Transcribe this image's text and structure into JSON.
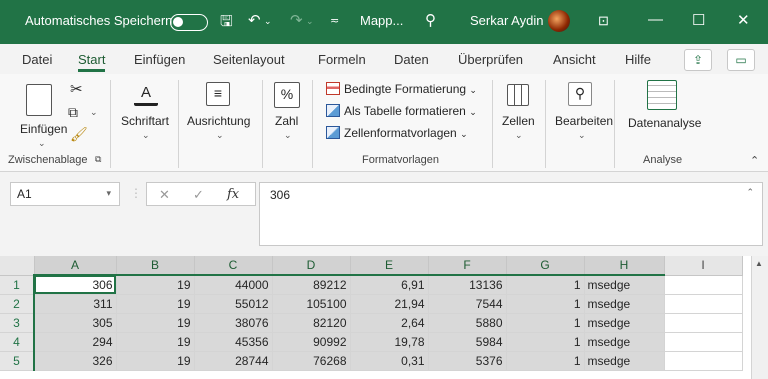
{
  "titlebar": {
    "autosave_label": "Automatisches Speichern",
    "filename": "Mapp...",
    "user_name": "Serkar Aydin"
  },
  "tabs": [
    "Datei",
    "Start",
    "Einfügen",
    "Seitenlayout",
    "Formeln",
    "Daten",
    "Überprüfen",
    "Ansicht",
    "Hilfe"
  ],
  "ribbon": {
    "paste_label": "Einfügen",
    "clipboard_group": "Zwischenablage",
    "font_label": "Schriftart",
    "align_label": "Ausrichtung",
    "number_label": "Zahl",
    "cond_format": "Bedingte Formatierung",
    "table_format": "Als Tabelle formatieren",
    "cell_styles": "Zellenformatvorlagen",
    "styles_group": "Formatvorlagen",
    "cells_label": "Zellen",
    "edit_label": "Bearbeiten",
    "analysis_label": "Datenanalyse",
    "analysis_group": "Analyse"
  },
  "formula_bar": {
    "name_box": "A1",
    "fx_symbol": "fx",
    "value": "306"
  },
  "sheet": {
    "columns": [
      "A",
      "B",
      "C",
      "D",
      "E",
      "F",
      "G",
      "H",
      "I"
    ],
    "rows": [
      {
        "n": "1",
        "cells": [
          "306",
          "19",
          "44000",
          "89212",
          "6,91",
          "13136",
          "1",
          "msedge",
          ""
        ]
      },
      {
        "n": "2",
        "cells": [
          "311",
          "19",
          "55012",
          "105100",
          "21,94",
          "7544",
          "1",
          "msedge",
          ""
        ]
      },
      {
        "n": "3",
        "cells": [
          "305",
          "19",
          "38076",
          "82120",
          "2,64",
          "5880",
          "1",
          "msedge",
          ""
        ]
      },
      {
        "n": "4",
        "cells": [
          "294",
          "19",
          "45356",
          "90992",
          "19,78",
          "5984",
          "1",
          "msedge",
          ""
        ]
      },
      {
        "n": "5",
        "cells": [
          "326",
          "19",
          "28744",
          "76268",
          "0,31",
          "5376",
          "1",
          "msedge",
          ""
        ]
      }
    ]
  },
  "colors": {
    "accent": "#217346",
    "selection": "#d9d9d9"
  }
}
